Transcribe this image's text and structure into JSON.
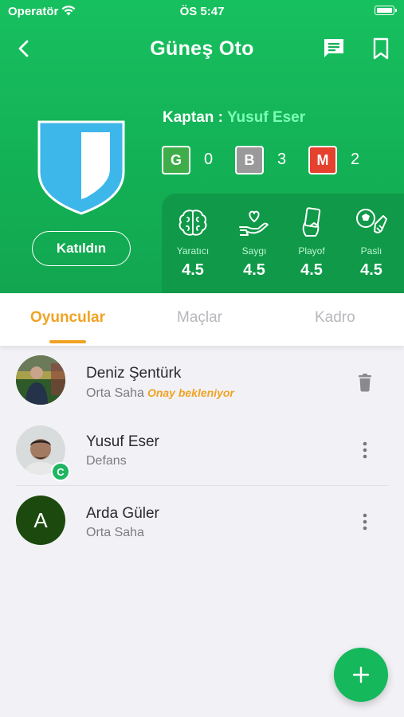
{
  "status_bar": {
    "carrier": "Operatör",
    "time": "ÖS 5:47"
  },
  "nav": {
    "title": "Güneş Oto"
  },
  "team": {
    "join_label": "Katıldın",
    "captain_label": "Kaptan :",
    "captain_name": "Yusuf Eser",
    "stats": [
      {
        "letter": "G",
        "value": "0",
        "color": "#3fae4a"
      },
      {
        "letter": "B",
        "value": "3",
        "color": "#9a9a9a"
      },
      {
        "letter": "M",
        "value": "2",
        "color": "#e5412f"
      }
    ]
  },
  "traits": [
    {
      "icon": "brain-icon",
      "label": "Yaratıcı",
      "value": "4.5"
    },
    {
      "icon": "heart-hand-icon",
      "label": "Saygı",
      "value": "4.5"
    },
    {
      "icon": "card-hand-icon",
      "label": "Playof",
      "value": "4.5"
    },
    {
      "icon": "ball-kick-icon",
      "label": "Paslı",
      "value": "4.5"
    }
  ],
  "tabs": [
    {
      "label": "Oyuncular",
      "active": true
    },
    {
      "label": "Maçlar",
      "active": false
    },
    {
      "label": "Kadro",
      "active": false
    }
  ],
  "players": [
    {
      "name": "Deniz Şentürk",
      "position": "Orta Saha",
      "status": "Onay bekleniyor",
      "action": "trash-icon"
    },
    {
      "name": "Yusuf Eser",
      "position": "Defans",
      "badge": "C",
      "action": "more-vertical-icon"
    },
    {
      "name": "Arda Güler",
      "position": "Orta Saha",
      "initial": "A",
      "action": "more-vertical-icon"
    }
  ],
  "colors": {
    "brand_green": "#17c05f",
    "accent_orange": "#f0a323",
    "shield_blue": "#3db6ea"
  }
}
